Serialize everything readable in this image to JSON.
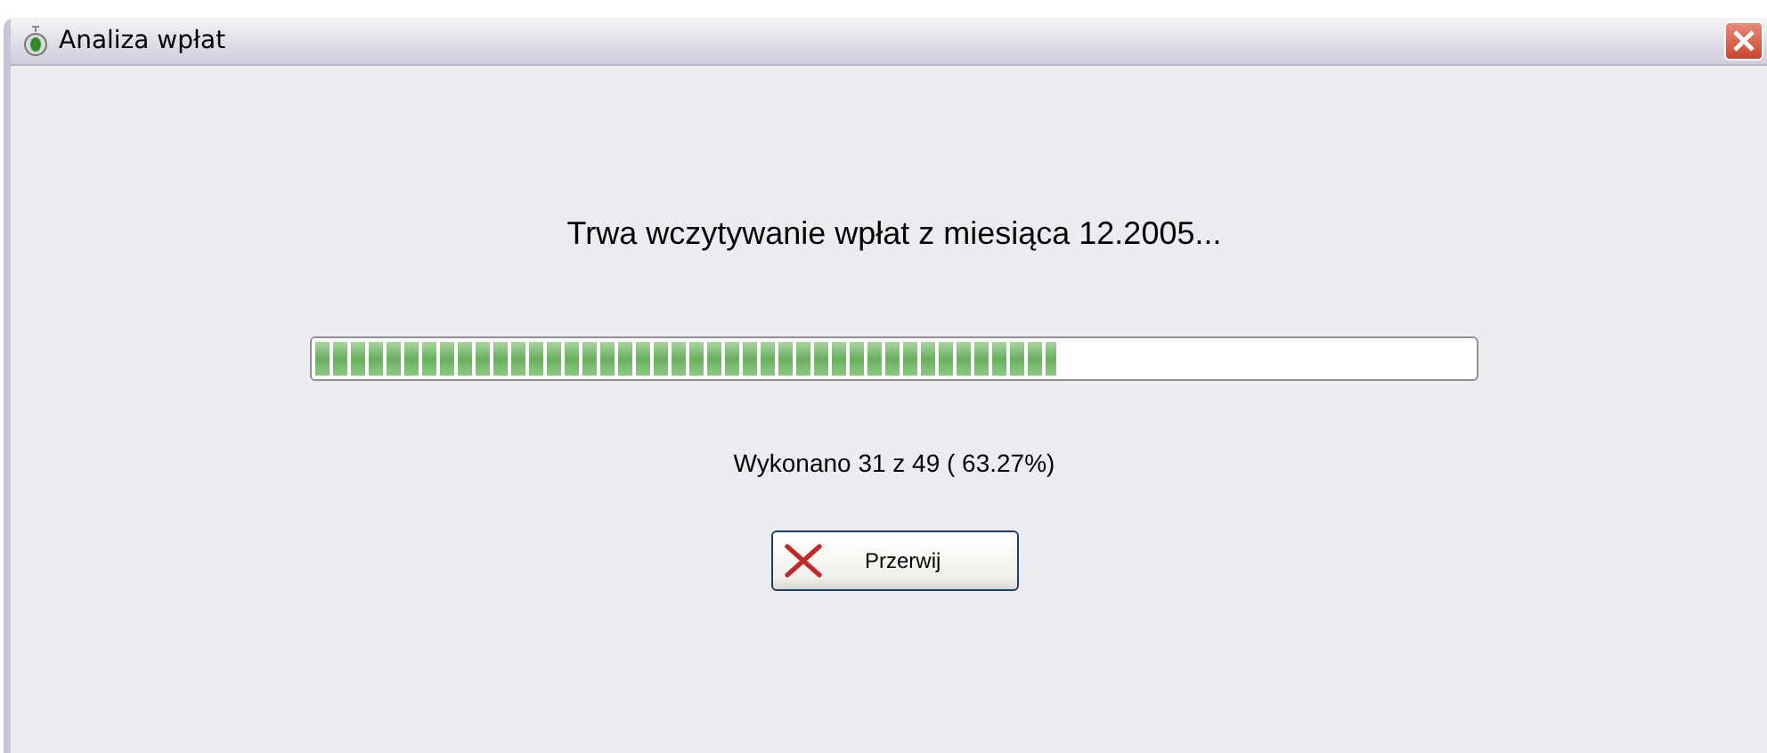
{
  "window": {
    "title": "Analiza wpłat"
  },
  "heading": "Trwa wczytywanie wpłat z miesiąca 12.2005...",
  "progress": {
    "level": 0.64
  },
  "status": "Wykonano 31 z 49 ( 63.27%)",
  "buttons": [
    {
      "label": "Przerwij",
      "kind": "cancel"
    }
  ]
}
